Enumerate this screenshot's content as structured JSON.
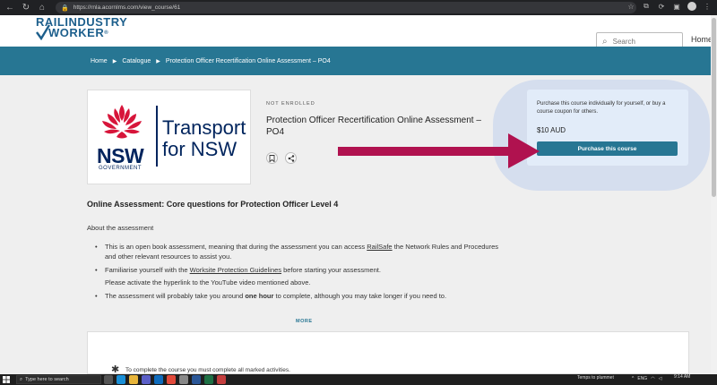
{
  "browser": {
    "url": "https://rnla.acornlms.com/view_course/61"
  },
  "site": {
    "logo_line1": "RAILINDUSTRY",
    "logo_line2": "WORKER",
    "logo_tm": "®",
    "search_placeholder": "Search",
    "home_label": "Home"
  },
  "breadcrumb": {
    "items": [
      "Home",
      "Catalogue",
      "Protection Officer Recertification Online Assessment – PO4"
    ]
  },
  "course": {
    "image_text": {
      "nsw": "NSW",
      "government": "GOVERNMENT",
      "transport_line1": "Transport",
      "transport_line2": "for NSW"
    },
    "status": "NOT ENROLLED",
    "title": "Protection Officer Recertification Online Assessment – PO4",
    "bookmark_icon": "bookmark-icon",
    "share_icon": "share-icon"
  },
  "purchase": {
    "description": "Purchase this course individually for yourself, or buy a course coupon for others.",
    "price": "$10 AUD",
    "button_label": "Purchase this course",
    "highlight_color": "#d5deee",
    "arrow_color": "#b0124f"
  },
  "content": {
    "heading": "Online Assessment: Core questions for Protection Officer Level 4",
    "about": "About the assessment",
    "bullet1_pre": "This is an open book assessment, meaning that during the assessment you can access ",
    "bullet1_link": "RailSafe",
    "bullet1_post": " the Network Rules and Procedures and other relevant resources to assist you.",
    "bullet2_pre": "Familiarise yourself with the ",
    "bullet2_link": "Worksite Protection Guidelines",
    "bullet2_post": " before starting your assessment.",
    "bullet2_sub": "Please activate the hyperlink to the YouTube video mentioned above.",
    "bullet3_pre": "The assessment will probably take you around ",
    "bullet3_bold": "one hour",
    "bullet3_post": " to complete, although you may take longer if you need to.",
    "more_label": "MORE"
  },
  "completion": {
    "note": "To complete the course you must complete all marked activities."
  },
  "taskbar": {
    "search_placeholder": "Type here to search",
    "weather": "Temps to plummet",
    "lang": "ENG",
    "time": "9:14 AM"
  },
  "colors": {
    "brand_blue": "#277693",
    "logo_blue": "#1d5f8c",
    "nsw_navy": "#00245d",
    "waratah_red": "#d7153a"
  }
}
